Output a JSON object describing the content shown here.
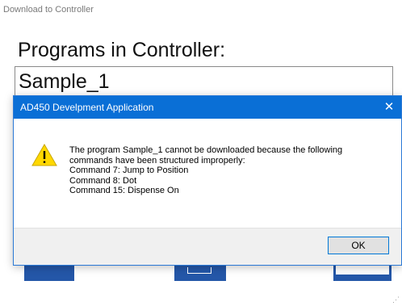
{
  "window": {
    "title": "Download to Controller",
    "heading": "Programs in Controller:",
    "programs": [
      "Sample_1"
    ]
  },
  "dialog": {
    "title": "AD450 Develpment Application",
    "close_glyph": "✕",
    "icon": "warning-icon",
    "message_lines": [
      "The program Sample_1 cannot be downloaded because the following",
      "commands have been structured improperly:",
      "Command 7: Jump to Position",
      "Command 8: Dot",
      "Command 15: Dispense On"
    ],
    "ok_label": "OK"
  },
  "colors": {
    "titlebar": "#0a6fd6",
    "accent_buttons": "#2457a8",
    "warning_fill": "#ffd800"
  }
}
